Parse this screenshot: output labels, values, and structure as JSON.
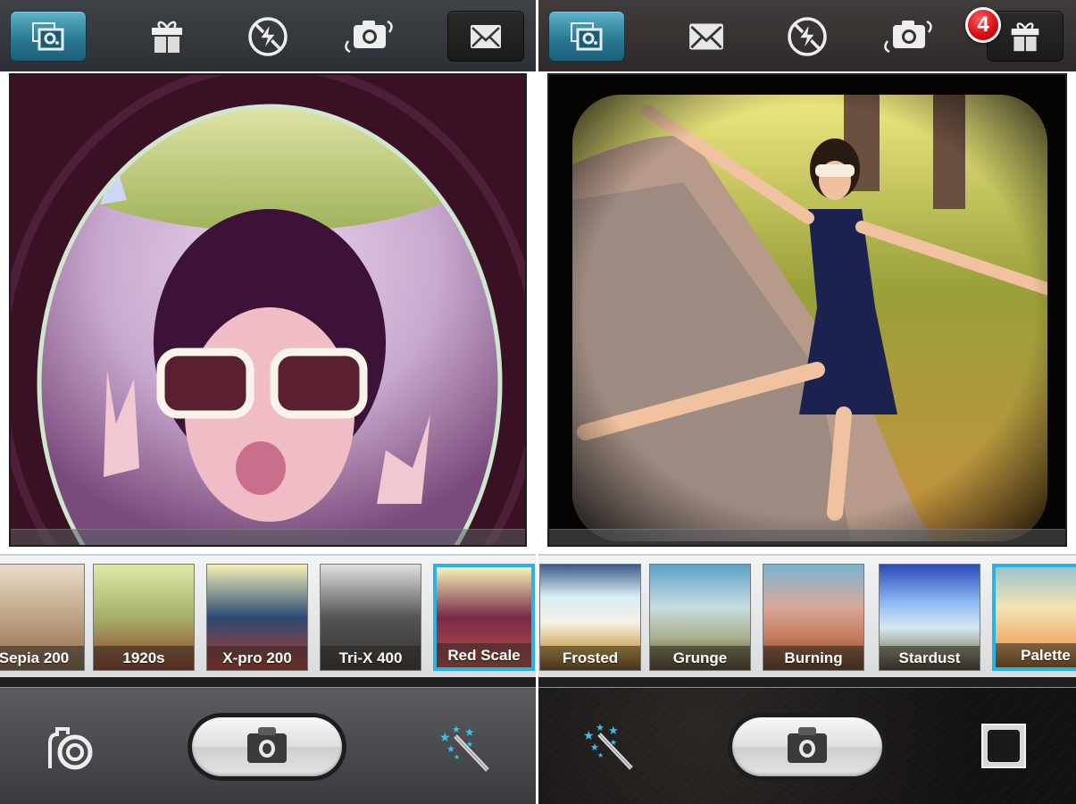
{
  "screens": [
    {
      "name": "left",
      "toolbar": {
        "buttons": [
          {
            "icon": "photo-library-settings-icon",
            "state": "active"
          },
          {
            "icon": "gift-icon",
            "state": "plain"
          },
          {
            "icon": "flash-off-icon",
            "state": "plain"
          },
          {
            "icon": "switch-camera-icon",
            "state": "plain"
          },
          {
            "icon": "mail-icon",
            "state": "dark"
          }
        ]
      },
      "photo": {
        "description": "Fisheye lens photo of woman in white sunglasses making peace signs",
        "filter_look": "Red Scale fisheye"
      },
      "filters": [
        {
          "label": "Sepia 200",
          "selected": false
        },
        {
          "label": "1920s",
          "selected": false
        },
        {
          "label": "X-pro 200",
          "selected": false
        },
        {
          "label": "Tri-X 400",
          "selected": false
        },
        {
          "label": "Red Scale",
          "selected": true
        }
      ],
      "bottom_bar": {
        "left_icon": "camera-lens-options-icon",
        "center": "shutter-camera-icon",
        "right_icon": "magic-wand-icon"
      }
    },
    {
      "name": "right",
      "toolbar": {
        "buttons": [
          {
            "icon": "photo-library-settings-icon",
            "state": "active"
          },
          {
            "icon": "mail-icon",
            "state": "plain"
          },
          {
            "icon": "flash-off-icon",
            "state": "plain"
          },
          {
            "icon": "switch-camera-icon",
            "state": "plain"
          },
          {
            "icon": "gift-icon",
            "state": "dark"
          }
        ],
        "badge": "4"
      },
      "photo": {
        "description": "Vintage TTV-style photo of woman in navy dress posing on a park path",
        "filter_look": "Palette"
      },
      "filters": [
        {
          "label": "Frosted",
          "selected": false
        },
        {
          "label": "Grunge",
          "selected": false
        },
        {
          "label": "Burning",
          "selected": false
        },
        {
          "label": "Stardust",
          "selected": false
        },
        {
          "label": "Palette",
          "selected": true
        }
      ],
      "bottom_bar": {
        "left_icon": "magic-wand-icon",
        "center": "shutter-camera-icon",
        "right_icon": "square-frame-icon"
      }
    }
  ],
  "colors": {
    "accent_blue": "#25b4e4",
    "active_button": "#2a7a95",
    "badge_red": "#d40d12"
  }
}
